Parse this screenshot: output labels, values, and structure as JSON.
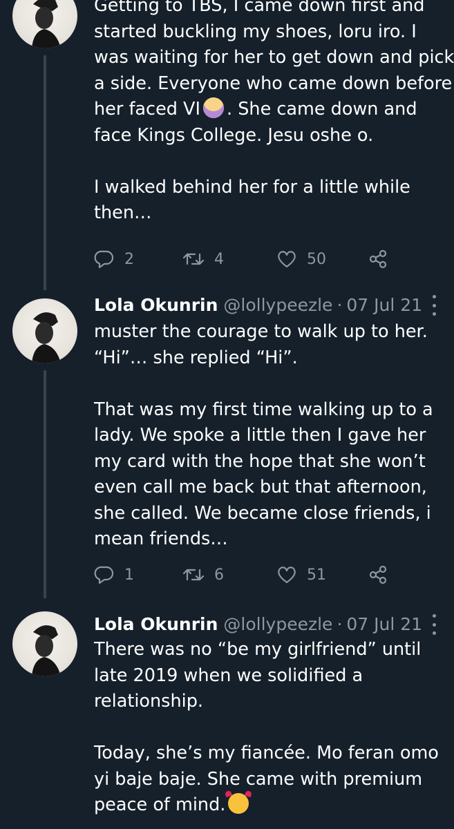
{
  "tweets": [
    {
      "text_lines": [
        "Getting to TBS, I came down first and",
        "started buckling my shoes, loru iro. I",
        "was waiting for her to get down and pick",
        "a side. Everyone who came down before",
        "her faced VI",
        ". She came down and",
        "face Kings College. Jesu oshe o.",
        "I walked behind her for a little while",
        "then…"
      ],
      "emoji_names": [
        "woman-shrugging-emoji"
      ],
      "replies": "2",
      "retweets": "4",
      "likes": "50"
    },
    {
      "name": "Lola Okunrin",
      "handle": "@lollypeezle",
      "separator": "·",
      "date": "07 Jul 21",
      "text_lines": [
        "muster the courage to walk up to her.",
        "“Hi”… she replied “Hi”.",
        "That was my first time walking up to a",
        "lady. We spoke a little then I gave her",
        "my card with the hope that she won’t",
        "even call me back but that afternoon,",
        "she called. We became close friends, i",
        "mean friends…"
      ],
      "replies": "1",
      "retweets": "6",
      "likes": "51"
    },
    {
      "name": "Lola Okunrin",
      "handle": "@lollypeezle",
      "separator": "·",
      "date": "07 Jul 21",
      "text_lines": [
        "There was no “be my girlfriend” until",
        "late 2019 when we solidified a",
        "relationship.",
        "Today, she’s my fiancée. Mo feran omo",
        "yi baje baje. She came with premium",
        "peace of mind."
      ],
      "emoji_names": [
        "smiling-face-with-hearts-emoji"
      ]
    }
  ],
  "icons": {
    "reply": "reply-icon",
    "retweet": "retweet-icon",
    "like": "like-icon",
    "share": "share-icon",
    "more": "more-icon"
  },
  "colors": {
    "background": "#15202b",
    "text": "#ffffff",
    "secondary": "#8b98a5",
    "divider": "#38444d"
  }
}
